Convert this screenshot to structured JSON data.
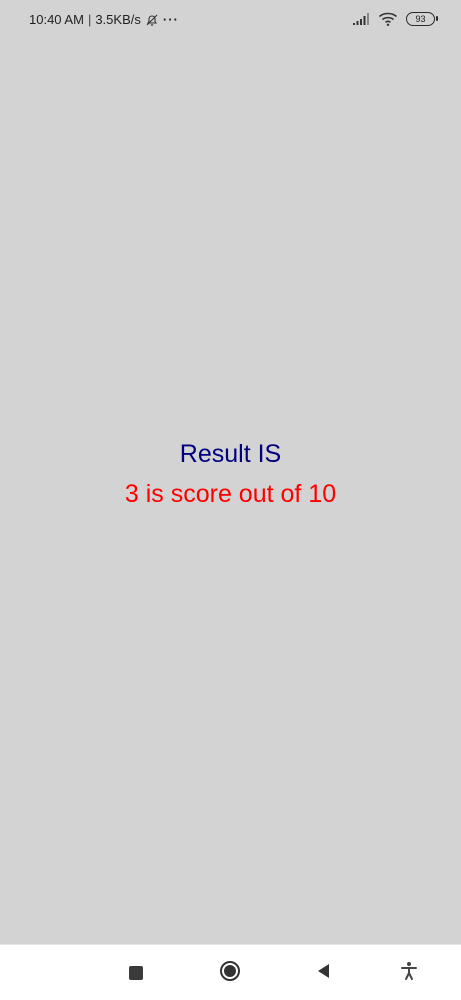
{
  "status_bar": {
    "time": "10:40 AM",
    "separator": "|",
    "network_speed": "3.5KB/s",
    "more_indicator": "···",
    "battery_level": "93",
    "icons": [
      "bell-muted-icon",
      "signal-icon",
      "wifi-icon",
      "battery-icon"
    ]
  },
  "main": {
    "title": "Result IS",
    "score_text": "3 is score out of 10",
    "title_color": "#00007f",
    "score_color": "#ff0000",
    "background": "#d3d3d3"
  },
  "nav_bar": {
    "icons": [
      "recent-apps-icon",
      "home-icon",
      "back-icon",
      "accessibility-icon"
    ]
  }
}
